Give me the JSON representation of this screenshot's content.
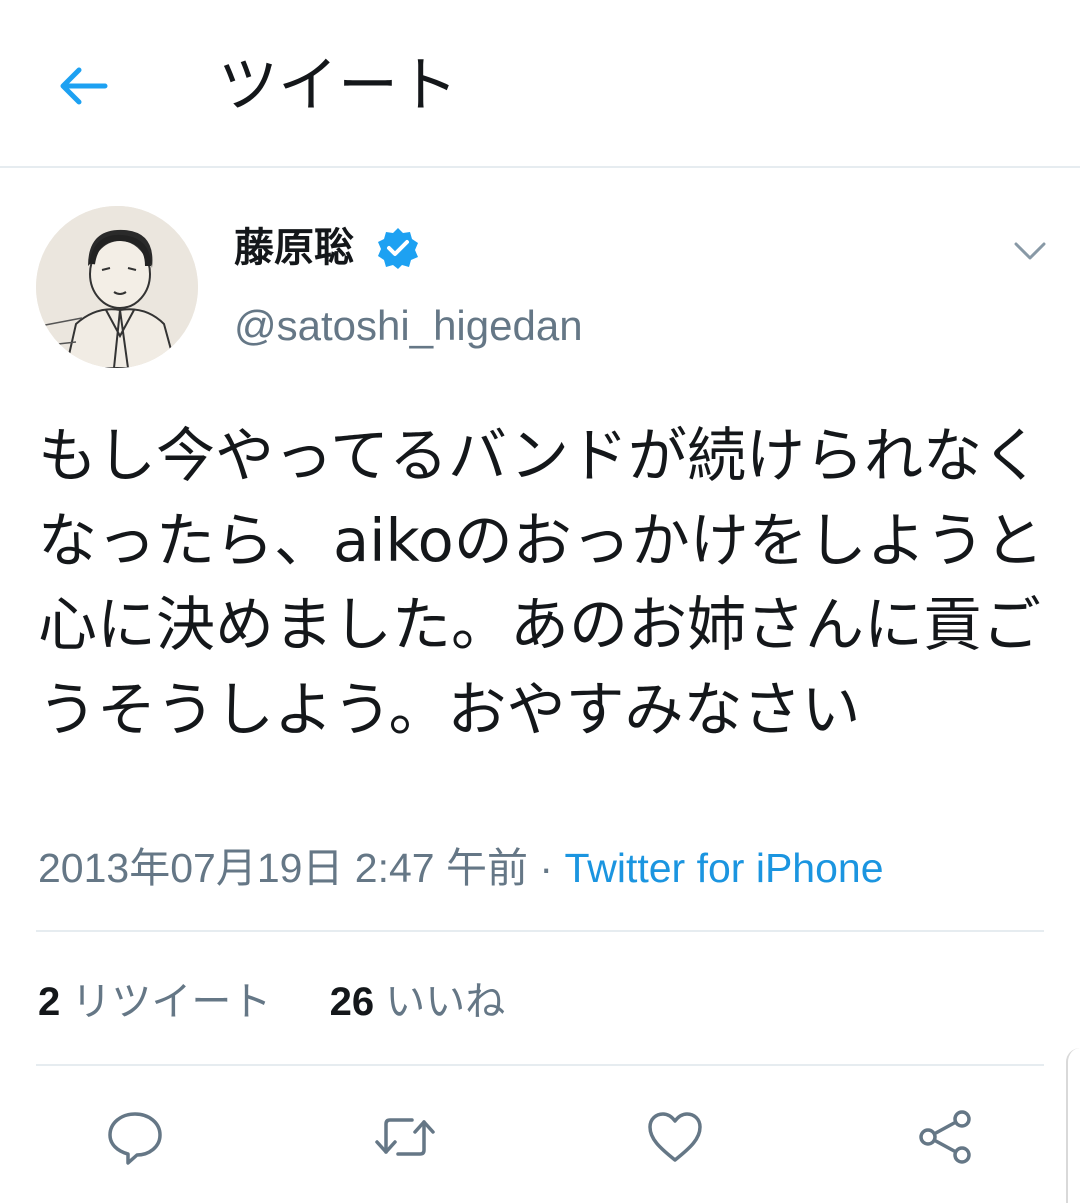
{
  "header": {
    "title": "ツイート",
    "back_icon": "arrow-left-icon",
    "accent_color": "#1da1f2"
  },
  "tweet": {
    "author": {
      "name": "藤原聡",
      "handle": "@satoshi_higedan",
      "verified": true
    },
    "text": "もし今やってるバンドが続けられなくなったら、aikoのおっかけをしようと心に決めました。あのお姉さんに貢ごうそうしよう。おやすみなさい",
    "timestamp": "2013年07月19日 2:47 午前",
    "separator": "·",
    "source": "Twitter for iPhone",
    "stats": {
      "retweets_count": "2",
      "retweets_label": "リツイート",
      "likes_count": "26",
      "likes_label": "いいね"
    }
  },
  "actions": [
    {
      "icon": "reply-icon"
    },
    {
      "icon": "retweet-icon"
    },
    {
      "icon": "like-icon"
    },
    {
      "icon": "share-icon"
    }
  ]
}
